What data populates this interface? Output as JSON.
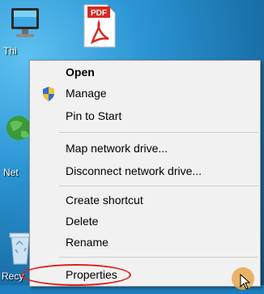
{
  "desktop": {
    "icons": [
      {
        "label": "Thi",
        "icon": "computer-icon"
      },
      {
        "label": "Net",
        "icon": "network-icon"
      },
      {
        "label": "Recy",
        "icon": "recycle-bin-icon"
      },
      {
        "label": "PDF",
        "icon": "pdf-file-icon"
      }
    ]
  },
  "context_menu": {
    "items": [
      {
        "label": "Open"
      },
      {
        "label": "Manage",
        "icon": "uac-shield-icon"
      },
      {
        "label": "Pin to Start"
      },
      {
        "label": "Map network drive..."
      },
      {
        "label": "Disconnect network drive..."
      },
      {
        "label": "Create shortcut"
      },
      {
        "label": "Delete"
      },
      {
        "label": "Rename"
      },
      {
        "label": "Properties"
      }
    ]
  },
  "colors": {
    "highlight": "#e0201c",
    "menu_bg": "#f1f1f1"
  }
}
